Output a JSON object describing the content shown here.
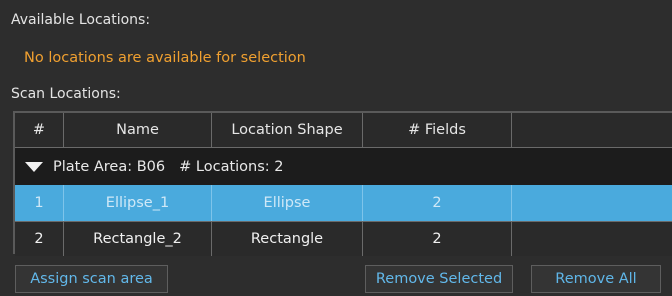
{
  "available_locations": {
    "label": "Available Locations:",
    "empty_message": "No locations are available for selection"
  },
  "scan_locations": {
    "label": "Scan Locations:",
    "columns": [
      "#",
      "Name",
      "Location Shape",
      "# Fields",
      ""
    ],
    "group": {
      "plate_area": "Plate Area: B06",
      "locations": "# Locations: 2"
    },
    "rows": [
      {
        "num": "1",
        "name": "Ellipse_1",
        "shape": "Ellipse",
        "fields": "2",
        "selected": true
      },
      {
        "num": "2",
        "name": "Rectangle_2",
        "shape": "Rectangle",
        "fields": "2",
        "selected": false
      }
    ]
  },
  "buttons": {
    "assign": "Assign scan area",
    "remove_selected": "Remove Selected",
    "remove_all": "Remove All"
  },
  "colors": {
    "background": "#2d2d2d",
    "warning_text": "#f0a030",
    "selection": "#4aaadd",
    "button_text": "#62b8ea"
  }
}
